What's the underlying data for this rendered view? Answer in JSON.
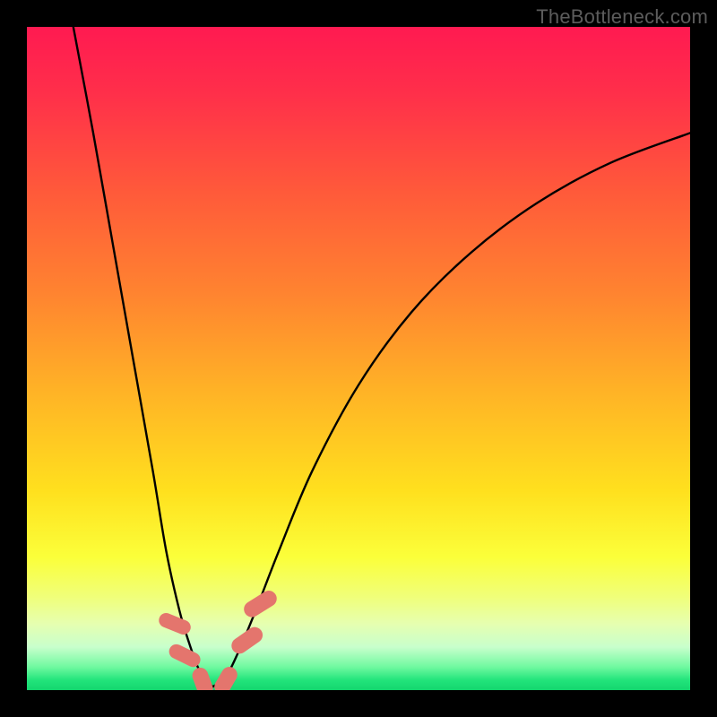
{
  "watermark": "TheBottleneck.com",
  "colors": {
    "frame": "#000000",
    "curve": "#000000",
    "marker_fill": "#e4756d",
    "marker_stroke": "#e4756d",
    "gradient_stops": [
      {
        "offset": 0.0,
        "color": "#ff1a51"
      },
      {
        "offset": 0.1,
        "color": "#ff2f4a"
      },
      {
        "offset": 0.25,
        "color": "#ff5a3a"
      },
      {
        "offset": 0.4,
        "color": "#ff8330"
      },
      {
        "offset": 0.55,
        "color": "#ffb326"
      },
      {
        "offset": 0.7,
        "color": "#ffe01e"
      },
      {
        "offset": 0.8,
        "color": "#fbff3a"
      },
      {
        "offset": 0.86,
        "color": "#f0ff7a"
      },
      {
        "offset": 0.9,
        "color": "#e6ffb0"
      },
      {
        "offset": 0.935,
        "color": "#c8ffcc"
      },
      {
        "offset": 0.965,
        "color": "#70f9a0"
      },
      {
        "offset": 0.985,
        "color": "#22e47b"
      },
      {
        "offset": 1.0,
        "color": "#14d66e"
      }
    ]
  },
  "chart_data": {
    "type": "line",
    "title": "",
    "xlabel": "",
    "ylabel": "",
    "xlim": [
      0,
      100
    ],
    "ylim": [
      0,
      100
    ],
    "note": "Axes are implicit (no ticks shown in source). Values are read as percentage of plot extent; y=0 is the green baseline at bottom, y=100 is top (red). The curve is a V-shaped bottleneck profile with minimum near x≈25–29.",
    "series": [
      {
        "name": "bottleneck-curve-left",
        "x": [
          7.0,
          10.0,
          13.0,
          16.0,
          19.0,
          21.0,
          23.0,
          24.5,
          26.0,
          28.0
        ],
        "values": [
          100.0,
          84.0,
          67.0,
          50.0,
          33.0,
          21.0,
          12.0,
          7.0,
          3.0,
          0.5
        ]
      },
      {
        "name": "bottleneck-curve-right",
        "x": [
          28.0,
          30.0,
          32.0,
          34.5,
          38.0,
          43.0,
          50.0,
          58.0,
          67.0,
          77.0,
          88.0,
          100.0
        ],
        "values": [
          0.5,
          2.0,
          6.0,
          12.0,
          21.0,
          33.0,
          46.0,
          57.0,
          66.0,
          73.5,
          79.5,
          84.0
        ]
      }
    ],
    "markers": [
      {
        "name": "left-upper",
        "x": 22.3,
        "y": 10.0,
        "w": 2.2,
        "h": 5.0,
        "angle": -68
      },
      {
        "name": "left-lower",
        "x": 23.8,
        "y": 5.2,
        "w": 2.2,
        "h": 5.0,
        "angle": -64
      },
      {
        "name": "bottom-left",
        "x": 26.5,
        "y": 1.2,
        "w": 2.4,
        "h": 4.5,
        "angle": -20
      },
      {
        "name": "bottom-right",
        "x": 30.0,
        "y": 1.4,
        "w": 2.4,
        "h": 4.5,
        "angle": 30
      },
      {
        "name": "right-lower",
        "x": 33.2,
        "y": 7.5,
        "w": 2.4,
        "h": 5.2,
        "angle": 55
      },
      {
        "name": "right-upper",
        "x": 35.2,
        "y": 13.0,
        "w": 2.4,
        "h": 5.4,
        "angle": 58
      }
    ]
  }
}
